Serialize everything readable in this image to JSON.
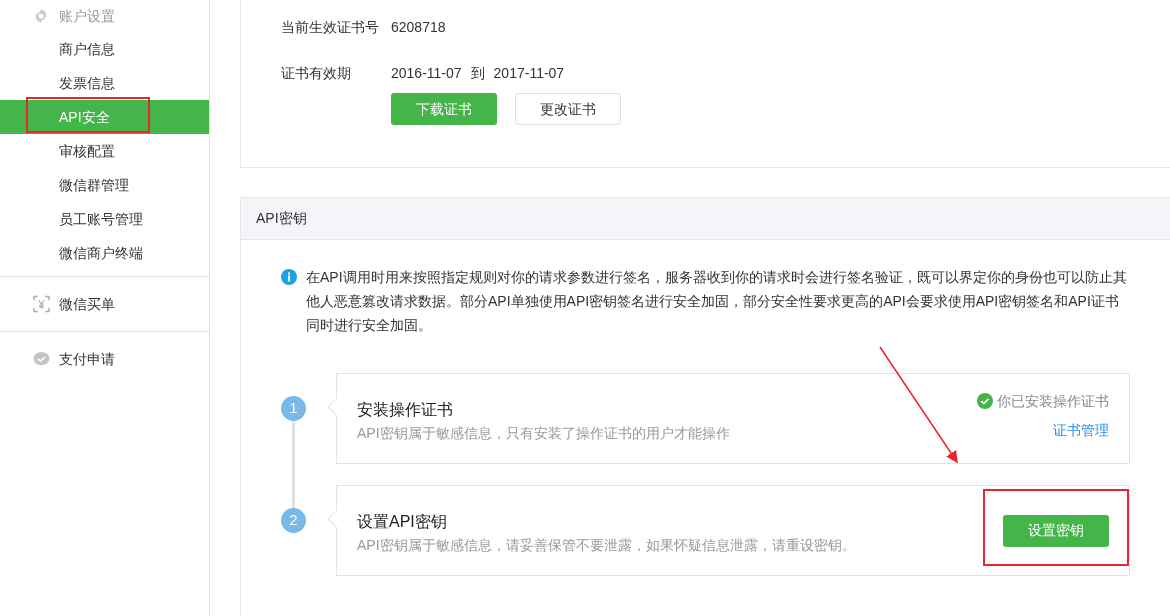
{
  "sidebar": {
    "sections": [
      {
        "kind": "group",
        "label": "账户设置",
        "items": [
          {
            "label": "商户信息",
            "selected": false
          },
          {
            "label": "发票信息",
            "selected": false
          },
          {
            "label": "API安全",
            "selected": true
          },
          {
            "label": "审核配置",
            "selected": false
          },
          {
            "label": "微信群管理",
            "selected": false
          },
          {
            "label": "员工账号管理",
            "selected": false
          },
          {
            "label": "微信商户终端",
            "selected": false
          }
        ]
      },
      {
        "kind": "link",
        "label": "微信买单"
      },
      {
        "kind": "link",
        "label": "支付申请"
      }
    ]
  },
  "certificate": {
    "fields": [
      {
        "label": "当前生效证书号",
        "value": "6208718"
      },
      {
        "label": "证书有效期",
        "value": "2016-11-07",
        "separator": "到",
        "value_end": "2017-11-07"
      }
    ],
    "buttons": [
      {
        "label": "下载证书",
        "kind": "primary"
      },
      {
        "label": "更改证书",
        "kind": "default"
      }
    ]
  },
  "api_key": {
    "title": "API密钥",
    "notice": "在API调用时用来按照指定规则对你的请求参数进行签名，服务器收到你的请求时会进行签名验证，既可以界定你的身份也可以防止其他人恶意篡改请求数据。部分API单独使用API密钥签名进行安全加固，部分安全性要求更高的API会要求使用API密钥签名和API证书同时进行安全加固。",
    "steps": [
      {
        "number": "1",
        "title": "安装操作证书",
        "description": "API密钥属于敏感信息，只有安装了操作证书的用户才能操作",
        "status": "你已安装操作证书",
        "link": "证书管理"
      },
      {
        "number": "2",
        "title": "设置API密钥",
        "description": "API密钥属于敏感信息，请妥善保管不要泄露，如果怀疑信息泄露，请重设密钥。",
        "button": "设置密钥"
      }
    ]
  }
}
